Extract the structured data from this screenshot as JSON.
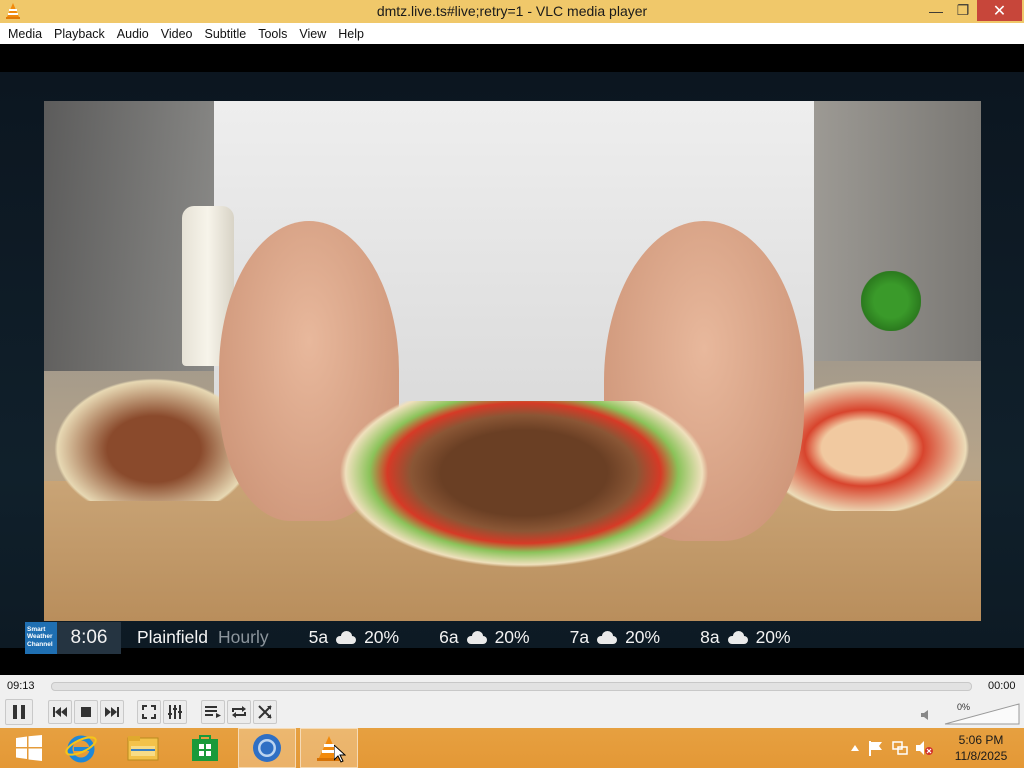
{
  "window": {
    "title": "dmtz.live.ts#live;retry=1 - VLC media player",
    "minimize_icon": "minimize-icon",
    "maximize_icon": "restore-icon",
    "close_icon": "close-icon"
  },
  "menu": [
    "Media",
    "Playback",
    "Audio",
    "Video",
    "Subtitle",
    "Tools",
    "View",
    "Help"
  ],
  "ticker": {
    "logo_text": "Smart Weather Channel",
    "time": "8:06",
    "city": "Plainfield",
    "mode": "Hourly",
    "forecast": [
      {
        "hour": "5a",
        "icon": "cloud-icon",
        "pct": "20%"
      },
      {
        "hour": "6a",
        "icon": "cloud-icon",
        "pct": "20%"
      },
      {
        "hour": "7a",
        "icon": "cloud-icon",
        "pct": "20%"
      },
      {
        "hour": "8a",
        "icon": "cloud-icon",
        "pct": "20%"
      }
    ]
  },
  "seek": {
    "elapsed": "09:13",
    "remaining": "00:00",
    "position_fraction": 0
  },
  "volume": {
    "label": "0%",
    "level_fraction": 0
  },
  "taskbar": {
    "apps": [
      "windows-start-icon",
      "internet-explorer-icon",
      "file-explorer-icon",
      "store-icon",
      "chrome-icon",
      "vlc-icon"
    ],
    "active_app": "vlc-icon",
    "clock_time": "5:06 PM",
    "clock_date": "11/8/2025"
  },
  "colors": {
    "titlebar": "#f0c86a",
    "close": "#c7463a",
    "taskbar": "#e49836",
    "ticker_logo": "#1f6fb2"
  }
}
